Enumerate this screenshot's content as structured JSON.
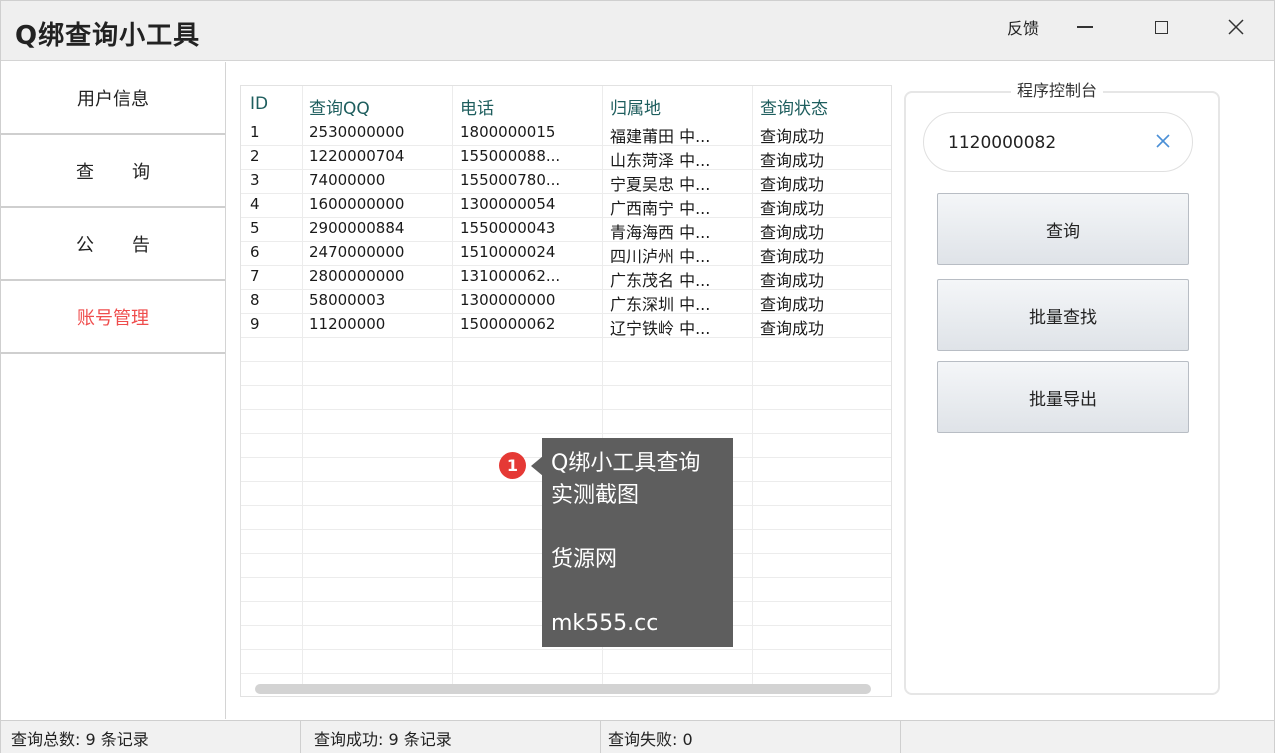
{
  "window": {
    "title": "Q绑查询小工具",
    "feedback_label": "反馈"
  },
  "sidebar": {
    "items": [
      {
        "label": "用户信息"
      },
      {
        "label": "查询"
      },
      {
        "label": "公告"
      },
      {
        "label": "账号管理"
      }
    ]
  },
  "table": {
    "columns": [
      "ID",
      "查询QQ",
      "电话",
      "归属地",
      "查询状态"
    ],
    "rows": [
      {
        "id": "1",
        "qq": "2530000000",
        "phone": "1800000015",
        "location": "福建莆田 中...",
        "status": "查询成功"
      },
      {
        "id": "2",
        "qq": "1220000704",
        "phone": "155000088...",
        "location": "山东菏泽 中...",
        "status": "查询成功"
      },
      {
        "id": "3",
        "qq": "74000000",
        "phone": "155000780...",
        "location": "宁夏吴忠 中...",
        "status": "查询成功"
      },
      {
        "id": "4",
        "qq": "1600000000",
        "phone": "1300000054",
        "location": "广西南宁 中...",
        "status": "查询成功"
      },
      {
        "id": "5",
        "qq": "2900000884",
        "phone": "1550000043",
        "location": "青海海西 中...",
        "status": "查询成功"
      },
      {
        "id": "6",
        "qq": "2470000000",
        "phone": "1510000024",
        "location": "四川泸州 中...",
        "status": "查询成功"
      },
      {
        "id": "7",
        "qq": "2800000000",
        "phone": "131000062...",
        "location": "广东茂名 中...",
        "status": "查询成功"
      },
      {
        "id": "8",
        "qq": "58000003",
        "phone": "1300000000",
        "location": "广东深圳 中...",
        "status": "查询成功"
      },
      {
        "id": "9",
        "qq": "11200000",
        "phone": "1500000062",
        "location": "辽宁铁岭 中...",
        "status": "查询成功"
      }
    ]
  },
  "tooltip": {
    "badge": "1",
    "lines": [
      "Q绑小工具查询",
      "实测截图",
      "",
      "货源网",
      "",
      "mk555.cc"
    ]
  },
  "console": {
    "title": "程序控制台",
    "qq_input_value": "1120000082",
    "buttons": {
      "query": "查询",
      "batch_find": "批量查找",
      "batch_export": "批量导出"
    }
  },
  "statusbar": {
    "total": "查询总数: 9 条记录",
    "success": "查询成功: 9 条记录",
    "failed": "查询失败: 0"
  },
  "icons": {
    "minimize": "minimize-icon",
    "maximize": "maximize-icon",
    "close": "close-icon",
    "clear": "clear-icon"
  },
  "colors": {
    "active_nav": "#ef4d4d",
    "header_text": "#1e5e5e",
    "tooltip_bg": "#5e5e5e",
    "badge": "#e53935",
    "clear_icon": "#4a8fd6"
  }
}
